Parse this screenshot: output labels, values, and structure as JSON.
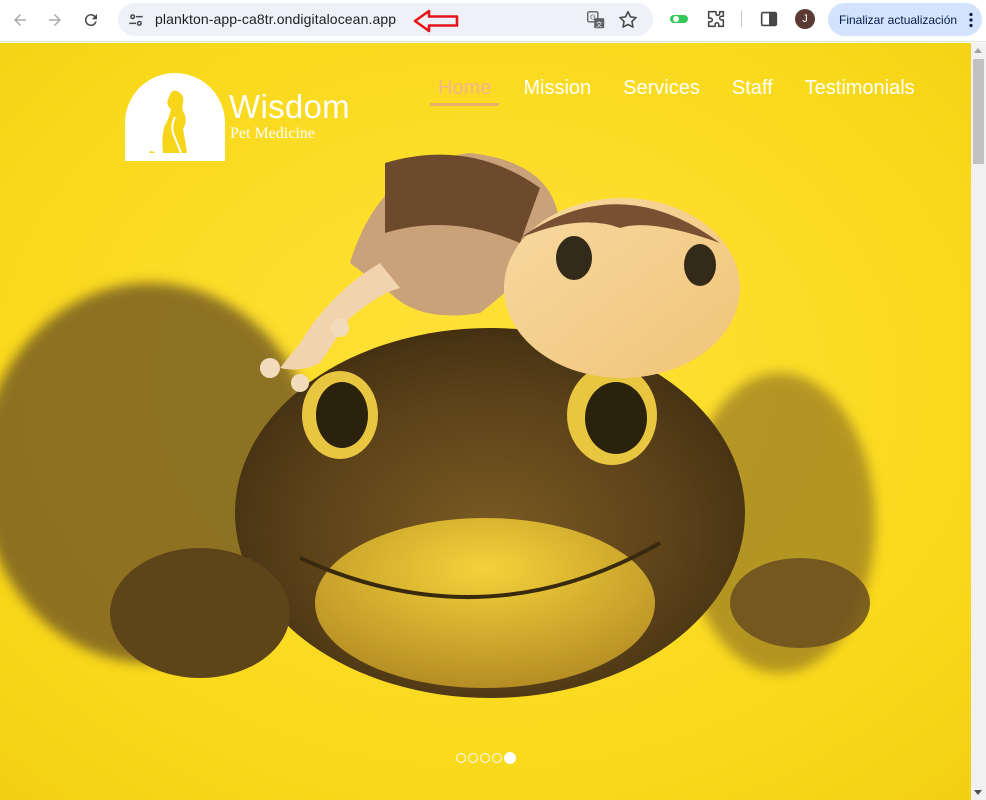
{
  "browser": {
    "url": "plankton-app-ca8tr.ondigitalocean.app",
    "update_label": "Finalizar actualización",
    "profile_initial": "J"
  },
  "site": {
    "brand_title": "Wisdom",
    "brand_subtitle": "Pet Medicine",
    "nav": [
      {
        "label": "Home",
        "active": true
      },
      {
        "label": "Mission",
        "active": false
      },
      {
        "label": "Services",
        "active": false
      },
      {
        "label": "Staff",
        "active": false
      },
      {
        "label": "Testimonials",
        "active": false
      }
    ],
    "hero_image": "two-geckos-on-yellow",
    "carousel": {
      "slides": 5,
      "active": 5
    }
  },
  "colors": {
    "accent_nav": "#f3b78c",
    "hero_bg": "#f6d51b",
    "update_btn": "#d3e3fd",
    "annotation_arrow": "#e8141b"
  }
}
